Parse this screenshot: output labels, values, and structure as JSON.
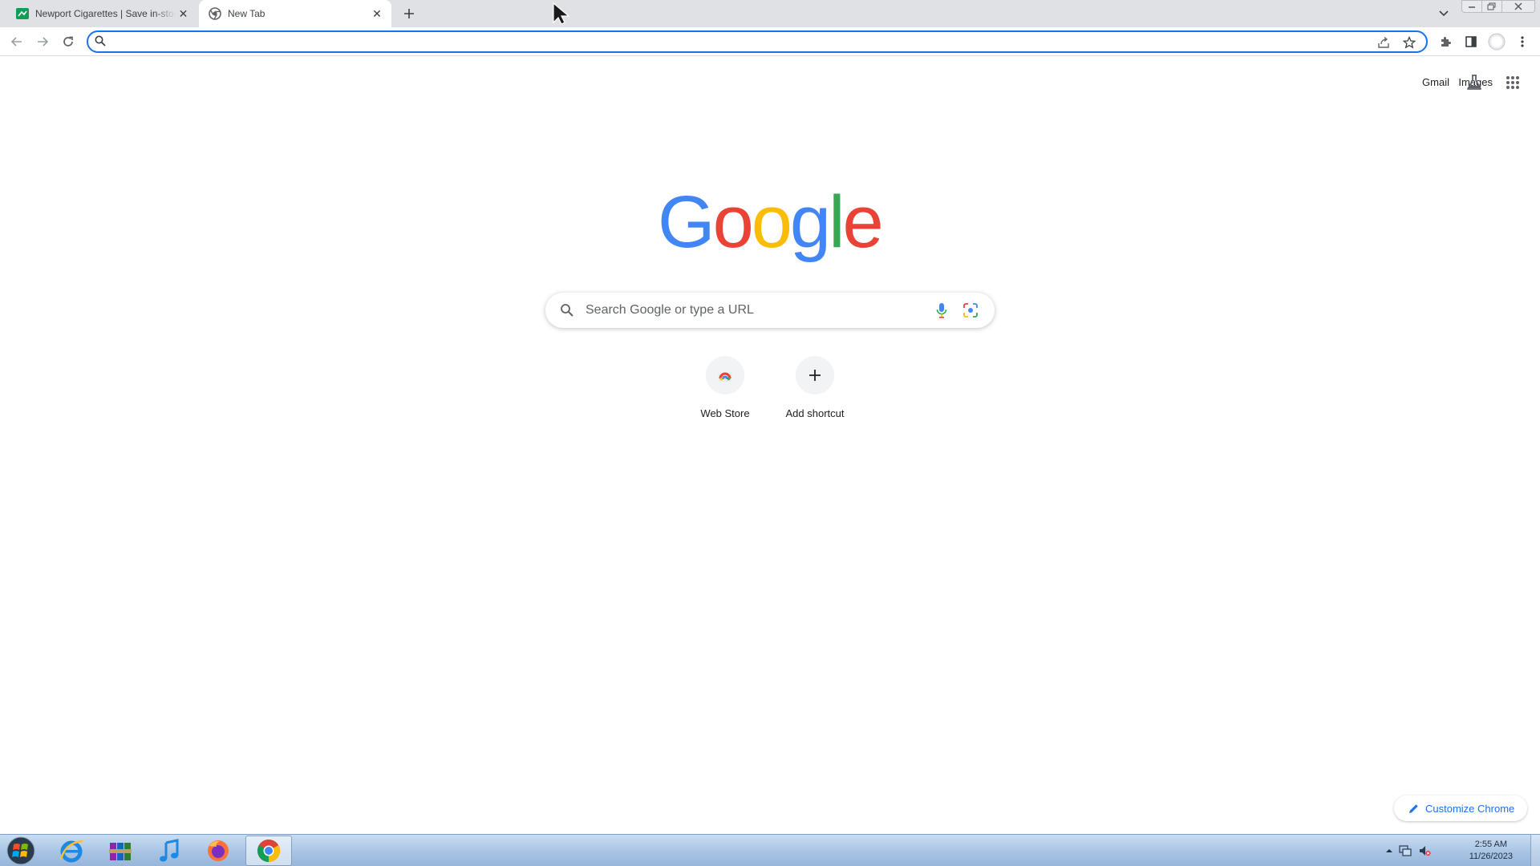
{
  "tabs": [
    {
      "title": "Newport Cigarettes | Save in-store",
      "active": false,
      "favicon": "newport-favicon"
    },
    {
      "title": "New Tab",
      "active": true,
      "favicon": "chrome-favicon"
    }
  ],
  "omnibox": {
    "value": "",
    "placeholder": ""
  },
  "top_links": {
    "gmail": "Gmail",
    "images": "Images"
  },
  "logo": {
    "letters": [
      "G",
      "o",
      "o",
      "g",
      "l",
      "e"
    ],
    "colors": [
      "#4285f4",
      "#ea4335",
      "#fbbc05",
      "#4285f4",
      "#34a853",
      "#ea4335"
    ]
  },
  "search": {
    "placeholder": "Search Google or type a URL"
  },
  "shortcuts": [
    {
      "label": "Web Store",
      "icon": "webstore-icon"
    },
    {
      "label": "Add shortcut",
      "icon": "plus-icon"
    }
  ],
  "customize": {
    "label": "Customize Chrome"
  },
  "taskbar": {
    "apps": [
      "internet-explorer-icon",
      "winrar-icon",
      "itunes-icon",
      "firefox-icon",
      "chrome-icon"
    ],
    "clock": {
      "time": "2:55 AM",
      "date": "11/26/2023"
    }
  },
  "colors": {
    "accent": "#1a73e8",
    "tabstrip": "#dfe1e5"
  }
}
